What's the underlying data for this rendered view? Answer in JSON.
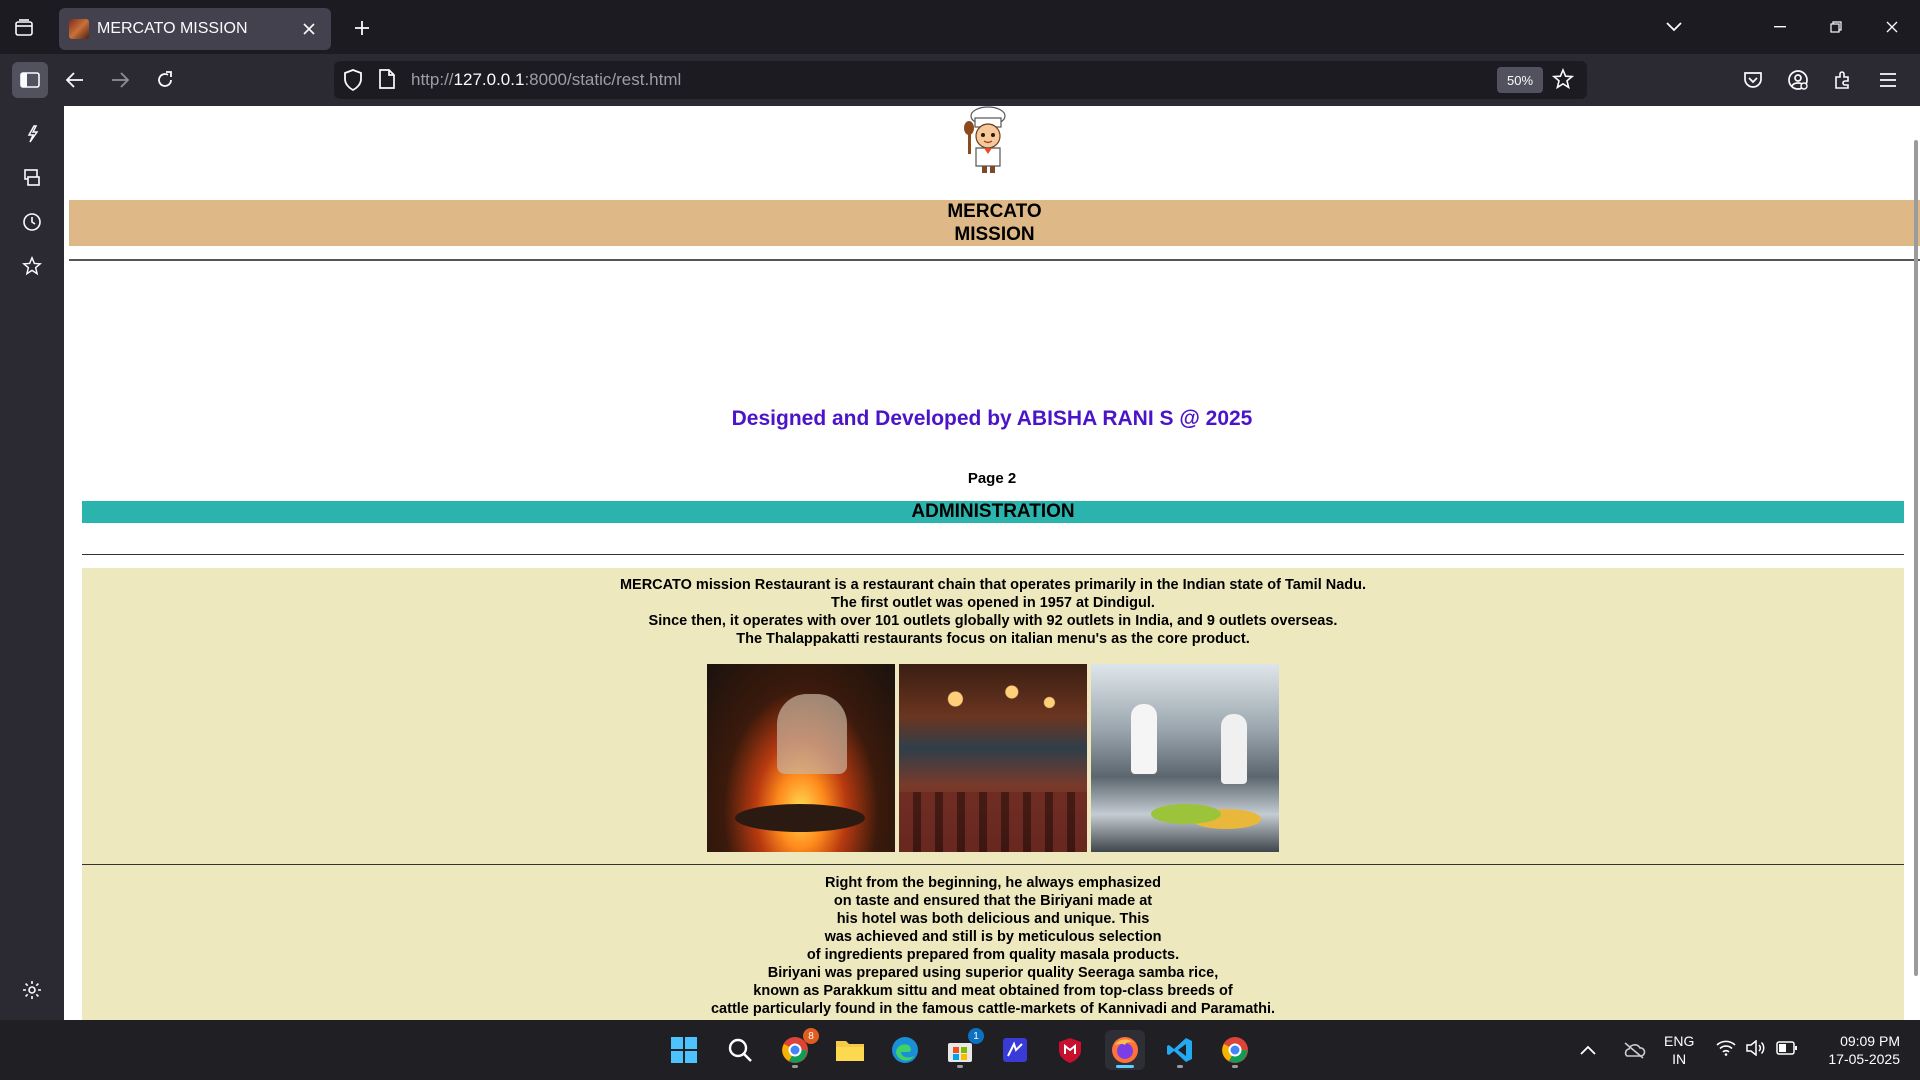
{
  "browser": {
    "tab_title": "MERCATO MISSION",
    "url_prefix": "http://",
    "url_host": "127.0.0.1",
    "url_rest": ":8000/static/rest.html",
    "zoom_level": "50%"
  },
  "page": {
    "title_line1": "MERCATO",
    "title_line2": "MISSION",
    "credit": "Designed and Developed by ABISHA RANI S @ 2025",
    "page_number": "Page 2",
    "section_heading": "ADMINISTRATION",
    "about_lines": [
      "MERCATO mission Restaurant is a restaurant chain that operates primarily in the Indian state of Tamil Nadu.",
      "The first outlet was opened in 1957 at Dindigul.",
      "Since then, it operates with over 101 outlets globally with 92 outlets in India, and 9 outlets overseas.",
      "The Thalappakatti restaurants focus on italian menu's as the core product."
    ],
    "story_lines": [
      "Right from the beginning, he always emphasized",
      "on taste and ensured that the Biriyani made at",
      "his hotel was both delicious and unique. This",
      "was achieved and still is by meticulous selection",
      "of ingredients prepared from quality masala products.",
      "Biriyani was prepared using superior quality Seeraga samba rice,",
      "known as Parakkum sittu and meat obtained from top-class breeds of",
      "cattle particularly found in the famous cattle-markets of Kannivadi and Paramathi."
    ],
    "colors": {
      "title_band": "#deb887",
      "credit_text": "#4b14c8",
      "admin_band": "#2bb3ad",
      "content_panel": "#eee8bf"
    }
  },
  "taskbar": {
    "chrome_badge": "8",
    "store_badge": "1",
    "language_line1": "ENG",
    "language_line2": "IN",
    "time": "09:09 PM",
    "date": "17-05-2025"
  }
}
